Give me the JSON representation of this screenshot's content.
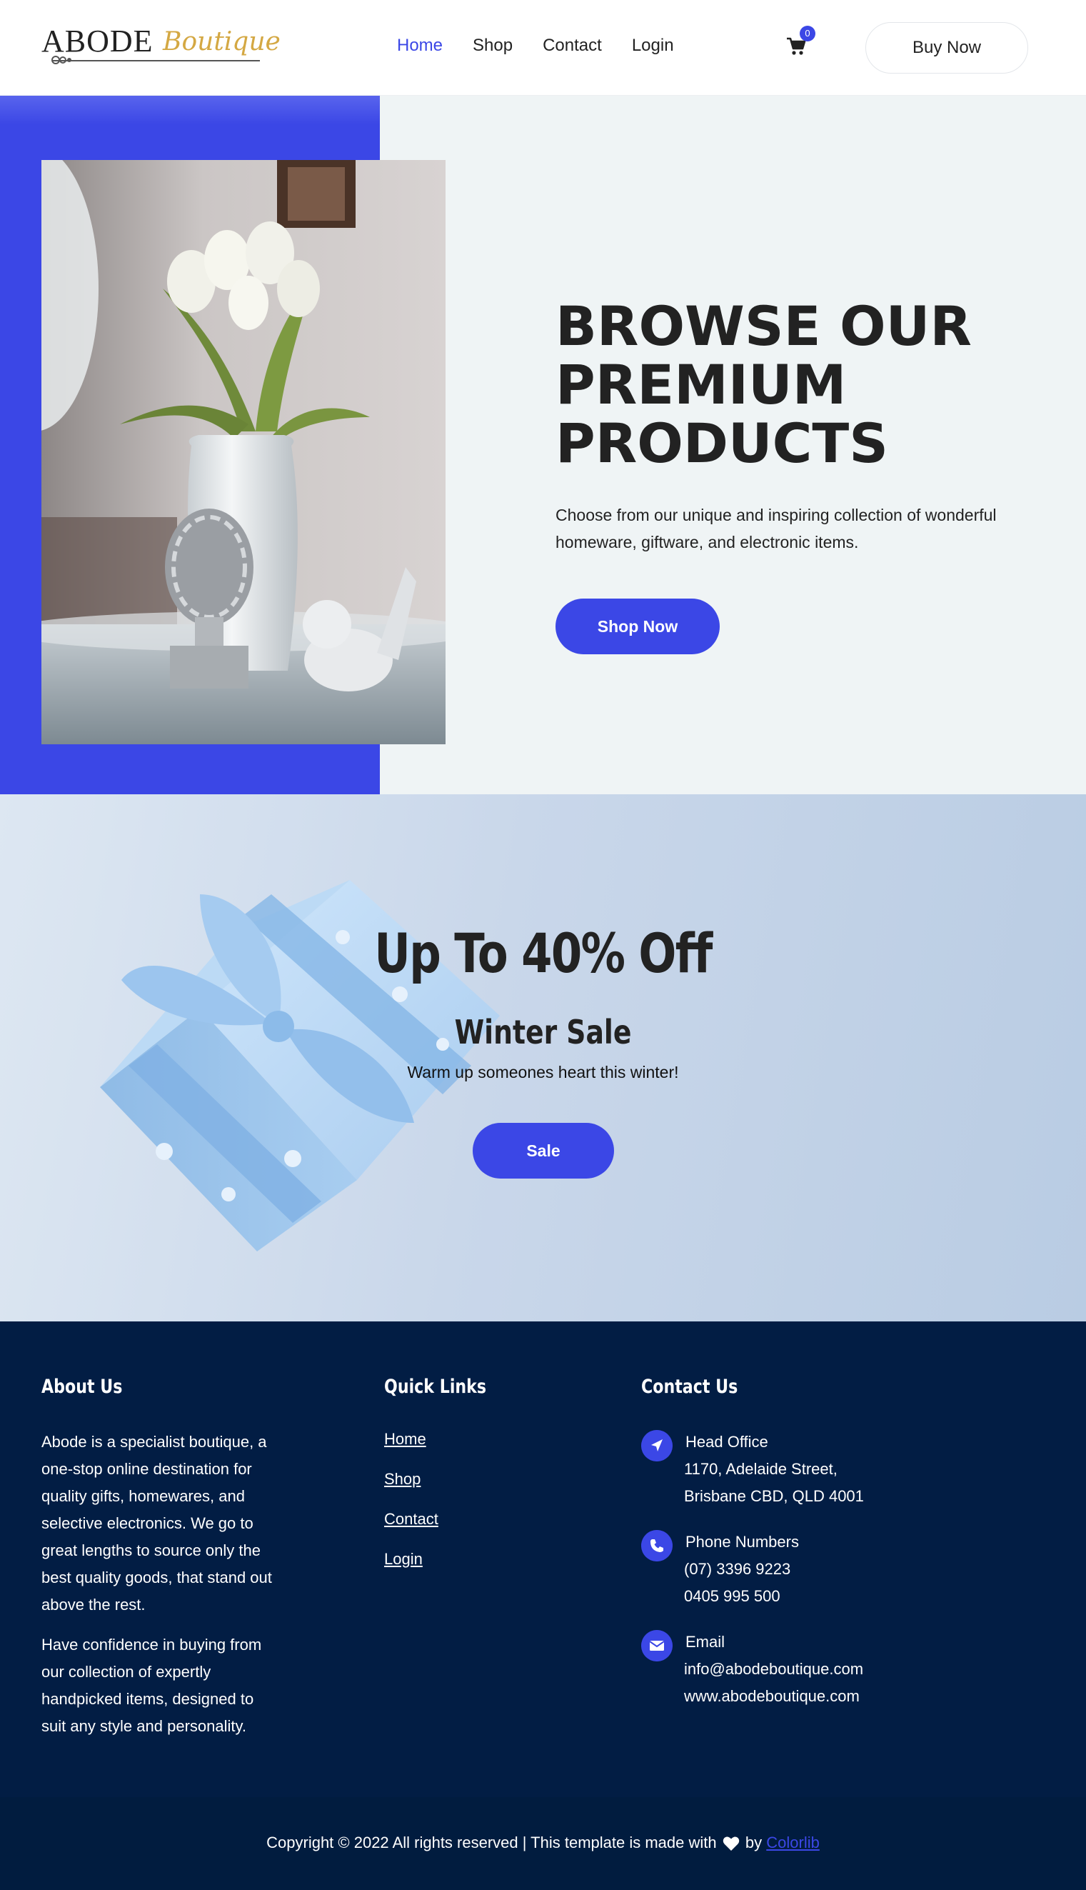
{
  "header": {
    "logo_main": "ABODE",
    "logo_script": "Boutique",
    "nav": [
      {
        "label": "Home",
        "active": true
      },
      {
        "label": "Shop",
        "active": false
      },
      {
        "label": "Contact",
        "active": false
      },
      {
        "label": "Login",
        "active": false
      }
    ],
    "cart_icon": "shopping-cart-icon",
    "cart_count": "0",
    "buy_label": "Buy Now"
  },
  "hero": {
    "title_lines": [
      "BROWSE OUR",
      "PREMIUM",
      "PRODUCTS"
    ],
    "subtitle": "Choose from our unique and inspiring collection of wonderful homeware, giftware, and electronic items.",
    "button": "Shop Now"
  },
  "sale": {
    "title": "Up To 40% Off",
    "subtitle": "Winter Sale",
    "description": "Warm up someones heart this winter!",
    "button": "Sale"
  },
  "footer": {
    "about": {
      "heading": "About Us",
      "paragraphs": [
        "Abode is a specialist boutique, a one-stop online destination for quality gifts, homewares, and selective electronics. We go to great lengths to source only the best quality goods, that stand out above the rest.",
        "Have confidence in buying from our collection of expertly handpicked items, designed to suit any style and personality."
      ]
    },
    "links": {
      "heading": "Quick Links",
      "items": [
        "Home",
        "Shop",
        "Contact",
        "Login"
      ]
    },
    "contact": {
      "heading": "Contact Us",
      "blocks": [
        {
          "icon": "location-arrow-icon",
          "title": "Head Office",
          "lines": [
            "1170, Adelaide Street,",
            "Brisbane CBD, QLD 4001"
          ]
        },
        {
          "icon": "phone-icon",
          "title": "Phone Numbers",
          "lines": [
            "(07) 3396 9223",
            "0405 995 500"
          ]
        },
        {
          "icon": "envelope-icon",
          "title": "Email",
          "lines": [
            "info@abodeboutique.com",
            "www.abodeboutique.com"
          ]
        }
      ]
    },
    "copyright_prefix": "Copyright © 2022 All rights reserved | This template is made with",
    "copyright_by": "by",
    "copyright_link": "Colorlib"
  },
  "colors": {
    "accent": "#3b47e6",
    "footer_bg": "#021d44",
    "hero_bg": "#eff4f5",
    "logo_gold": "#d4a843"
  }
}
